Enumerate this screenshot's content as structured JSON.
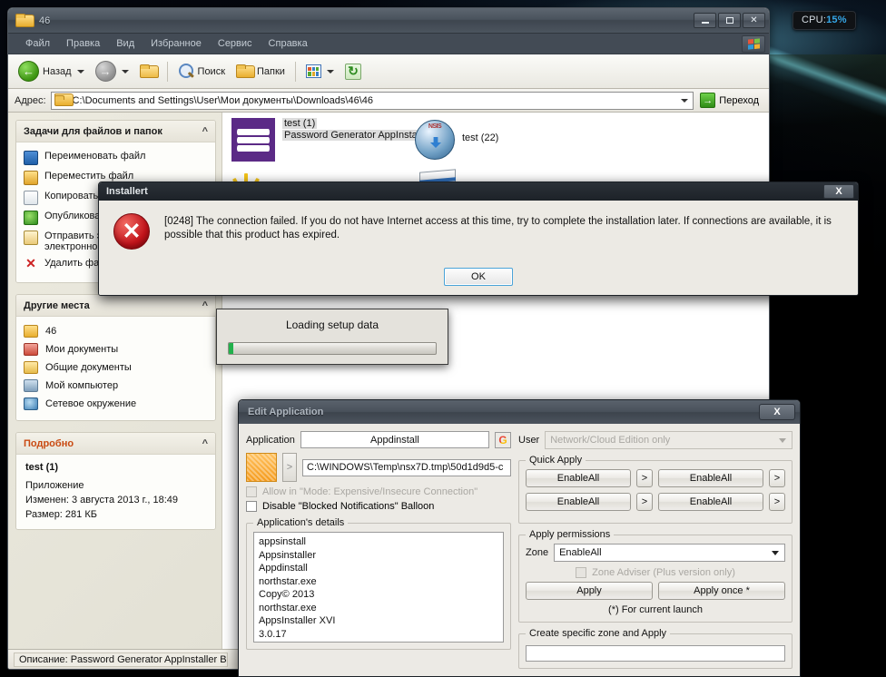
{
  "desktop": {
    "cpu_gadget": {
      "label": "CPU:",
      "value": "15%"
    }
  },
  "explorer": {
    "title": "46",
    "menus": [
      "Файл",
      "Правка",
      "Вид",
      "Избранное",
      "Сервис",
      "Справка"
    ],
    "toolbar": {
      "back": "Назад",
      "search": "Поиск",
      "folders": "Папки"
    },
    "address": {
      "label": "Адрес:",
      "value": "C:\\Documents and Settings\\User\\Мои документы\\Downloads\\46\\46",
      "go_label": "Переход"
    },
    "sidebar": {
      "tasks_panel": {
        "title": "Задачи для файлов и папок",
        "items": [
          "Переименовать файл",
          "Переместить файл",
          "Копировать файл",
          "Опубликовать файл в веб",
          "Отправить этот файл по электронной почте",
          "Удалить файл"
        ]
      },
      "places_panel": {
        "title": "Другие места",
        "items": [
          "46",
          "Мои документы",
          "Общие документы",
          "Мой компьютер",
          "Сетевое окружение"
        ]
      },
      "details_panel": {
        "title": "Подробно",
        "file_name": "test (1)",
        "file_type": "Приложение",
        "modified": "Изменен: 3 августа 2013 г., 18:49",
        "size": "Размер: 281 КБ"
      }
    },
    "files": [
      {
        "name": "test (1)",
        "subtitle": "Password Generator AppInsta...",
        "icon": "stacked-layers-icon"
      },
      {
        "name": "test (22)",
        "subtitle": "",
        "icon": "nsis-installer-icon"
      }
    ],
    "statusbar": "Описание: Password Generator AppInstaller Версия"
  },
  "installert_dialog": {
    "title": "Installert",
    "message": "[0248] The connection failed. If you do not have Internet access at this time, try to complete the installation later. If connections are available, it is possible that this product has expired.",
    "ok_label": "OK",
    "close_label": "X"
  },
  "loading_dialog": {
    "title": "Loading setup data",
    "progress_percent": 2
  },
  "edit_application": {
    "title": "Edit Application",
    "close_label": "X",
    "application_label": "Application",
    "application_name": "Appdinstall",
    "google_button": "G",
    "expand_button": ">",
    "path_value": "C:\\WINDOWS\\Temp\\nsx7D.tmp\\50d1d9d5-c",
    "checkbox_allow": "Allow in \"Mode: Expensive/Insecure Connection\"",
    "checkbox_disable": "Disable \"Blocked Notifications\" Balloon",
    "details_group": "Application's details",
    "details_lines": [
      "appsinstall",
      "Appsinstaller",
      "Appdinstall",
      "northstar.exe",
      "Copy© 2013",
      "northstar.exe",
      "AppsInstaller XVI",
      "3.0.17"
    ],
    "user_label": "User",
    "user_value": "Network/Cloud Edition only",
    "quick_apply_group": "Quick Apply",
    "quick_apply_buttons": [
      "EnableAll",
      "EnableAll",
      "EnableAll",
      "EnableAll"
    ],
    "quick_apply_more": ">",
    "apply_permissions_group": "Apply permissions",
    "zone_label": "Zone",
    "zone_value": "EnableAll",
    "zone_adviser": "Zone Adviser (Plus version only)",
    "apply_label": "Apply",
    "apply_once_label": "Apply once *",
    "footnote": "(*) For current launch",
    "create_zone_group": "Create specific zone and Apply"
  }
}
